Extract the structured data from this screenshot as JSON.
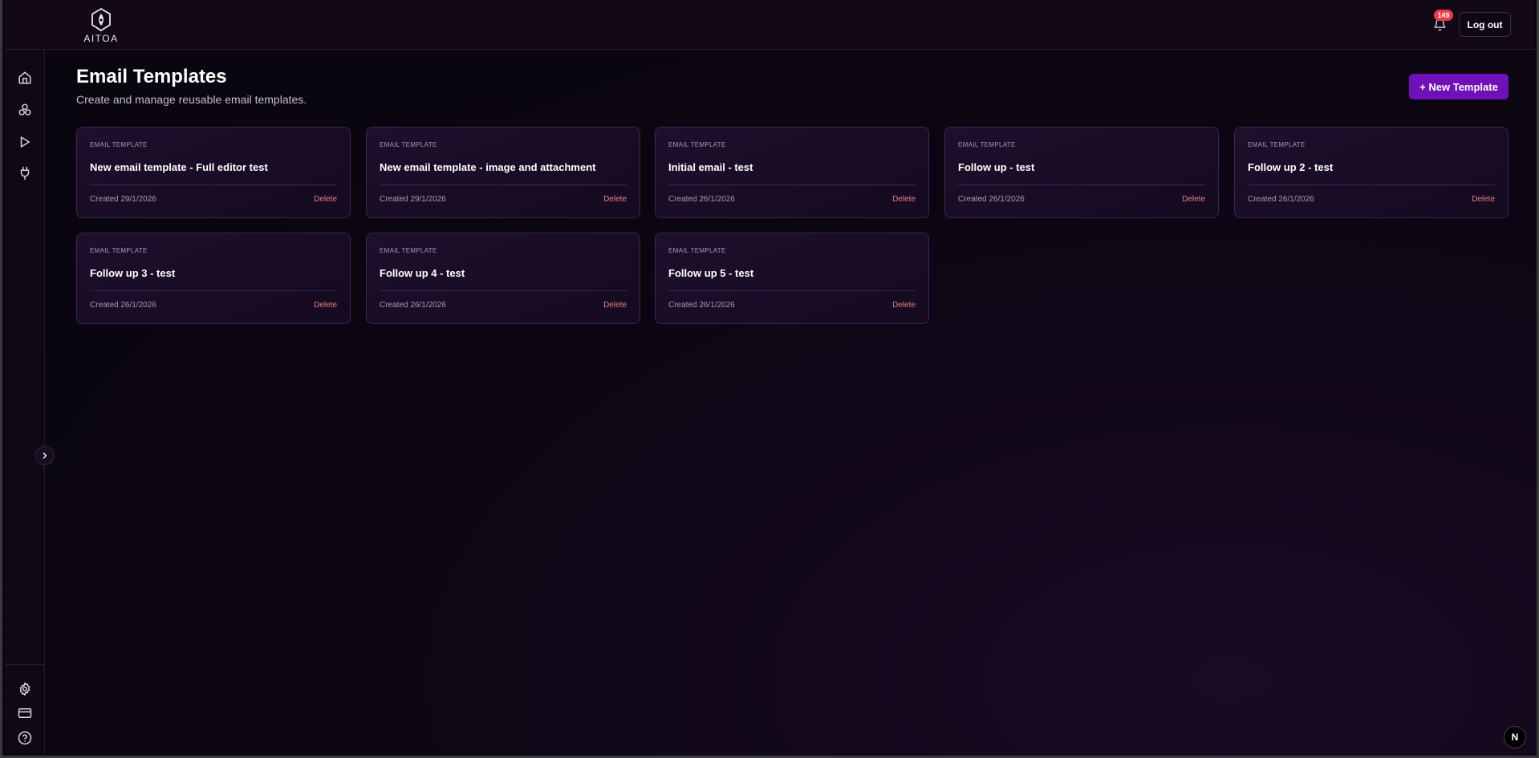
{
  "header": {
    "logo_text": "AITOA",
    "notification_count": "149",
    "logout_label": "Log out"
  },
  "sidebar": {
    "items": [
      {
        "name": "home",
        "icon": "home-icon"
      },
      {
        "name": "agents",
        "icon": "cluster-icon"
      },
      {
        "name": "runs",
        "icon": "play-icon"
      },
      {
        "name": "integrations",
        "icon": "plug-icon"
      }
    ],
    "bottom_items": [
      {
        "name": "settings",
        "icon": "gear-icon"
      },
      {
        "name": "billing",
        "icon": "credit-card-icon"
      },
      {
        "name": "help",
        "icon": "help-circle-icon"
      }
    ]
  },
  "main": {
    "title": "Email Templates",
    "subtitle": "Create and manage reusable email templates.",
    "new_button_label": "+ New Template",
    "templates": [
      {
        "kicker": "EMAIL TEMPLATE",
        "title": "New email template - Full editor test",
        "created": "Created 29/1/2026",
        "delete": "Delete"
      },
      {
        "kicker": "EMAIL TEMPLATE",
        "title": "New email template - image and attachment",
        "created": "Created 29/1/2026",
        "delete": "Delete"
      },
      {
        "kicker": "EMAIL TEMPLATE",
        "title": "Initial email - test",
        "created": "Created 26/1/2026",
        "delete": "Delete"
      },
      {
        "kicker": "EMAIL TEMPLATE",
        "title": "Follow up - test",
        "created": "Created 26/1/2026",
        "delete": "Delete"
      },
      {
        "kicker": "EMAIL TEMPLATE",
        "title": "Follow up 2 - test",
        "created": "Created 26/1/2026",
        "delete": "Delete"
      },
      {
        "kicker": "EMAIL TEMPLATE",
        "title": "Follow up 3 - test",
        "created": "Created 26/1/2026",
        "delete": "Delete"
      },
      {
        "kicker": "EMAIL TEMPLATE",
        "title": "Follow up 4 - test",
        "created": "Created 26/1/2026",
        "delete": "Delete"
      },
      {
        "kicker": "EMAIL TEMPLATE",
        "title": "Follow up 5 - test",
        "created": "Created 26/1/2026",
        "delete": "Delete"
      }
    ]
  },
  "dev_badge": "N",
  "colors": {
    "accent": "#6f10b8",
    "badge": "#ef3b47",
    "delete": "#e0827e",
    "card_border": "#3b2756"
  }
}
